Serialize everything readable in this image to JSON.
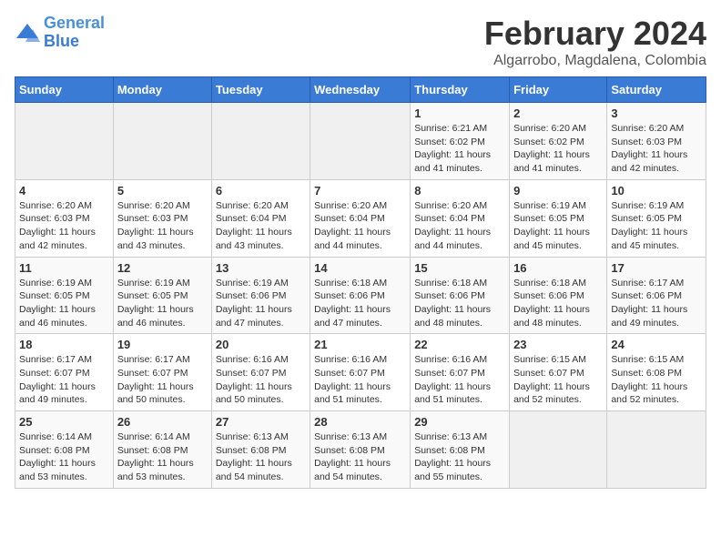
{
  "header": {
    "logo_line1": "General",
    "logo_line2": "Blue",
    "month": "February 2024",
    "location": "Algarrobo, Magdalena, Colombia"
  },
  "weekdays": [
    "Sunday",
    "Monday",
    "Tuesday",
    "Wednesday",
    "Thursday",
    "Friday",
    "Saturday"
  ],
  "weeks": [
    [
      {
        "day": "",
        "info": ""
      },
      {
        "day": "",
        "info": ""
      },
      {
        "day": "",
        "info": ""
      },
      {
        "day": "",
        "info": ""
      },
      {
        "day": "1",
        "info": "Sunrise: 6:21 AM\nSunset: 6:02 PM\nDaylight: 11 hours\nand 41 minutes."
      },
      {
        "day": "2",
        "info": "Sunrise: 6:20 AM\nSunset: 6:02 PM\nDaylight: 11 hours\nand 41 minutes."
      },
      {
        "day": "3",
        "info": "Sunrise: 6:20 AM\nSunset: 6:03 PM\nDaylight: 11 hours\nand 42 minutes."
      }
    ],
    [
      {
        "day": "4",
        "info": "Sunrise: 6:20 AM\nSunset: 6:03 PM\nDaylight: 11 hours\nand 42 minutes."
      },
      {
        "day": "5",
        "info": "Sunrise: 6:20 AM\nSunset: 6:03 PM\nDaylight: 11 hours\nand 43 minutes."
      },
      {
        "day": "6",
        "info": "Sunrise: 6:20 AM\nSunset: 6:04 PM\nDaylight: 11 hours\nand 43 minutes."
      },
      {
        "day": "7",
        "info": "Sunrise: 6:20 AM\nSunset: 6:04 PM\nDaylight: 11 hours\nand 44 minutes."
      },
      {
        "day": "8",
        "info": "Sunrise: 6:20 AM\nSunset: 6:04 PM\nDaylight: 11 hours\nand 44 minutes."
      },
      {
        "day": "9",
        "info": "Sunrise: 6:19 AM\nSunset: 6:05 PM\nDaylight: 11 hours\nand 45 minutes."
      },
      {
        "day": "10",
        "info": "Sunrise: 6:19 AM\nSunset: 6:05 PM\nDaylight: 11 hours\nand 45 minutes."
      }
    ],
    [
      {
        "day": "11",
        "info": "Sunrise: 6:19 AM\nSunset: 6:05 PM\nDaylight: 11 hours\nand 46 minutes."
      },
      {
        "day": "12",
        "info": "Sunrise: 6:19 AM\nSunset: 6:05 PM\nDaylight: 11 hours\nand 46 minutes."
      },
      {
        "day": "13",
        "info": "Sunrise: 6:19 AM\nSunset: 6:06 PM\nDaylight: 11 hours\nand 47 minutes."
      },
      {
        "day": "14",
        "info": "Sunrise: 6:18 AM\nSunset: 6:06 PM\nDaylight: 11 hours\nand 47 minutes."
      },
      {
        "day": "15",
        "info": "Sunrise: 6:18 AM\nSunset: 6:06 PM\nDaylight: 11 hours\nand 48 minutes."
      },
      {
        "day": "16",
        "info": "Sunrise: 6:18 AM\nSunset: 6:06 PM\nDaylight: 11 hours\nand 48 minutes."
      },
      {
        "day": "17",
        "info": "Sunrise: 6:17 AM\nSunset: 6:06 PM\nDaylight: 11 hours\nand 49 minutes."
      }
    ],
    [
      {
        "day": "18",
        "info": "Sunrise: 6:17 AM\nSunset: 6:07 PM\nDaylight: 11 hours\nand 49 minutes."
      },
      {
        "day": "19",
        "info": "Sunrise: 6:17 AM\nSunset: 6:07 PM\nDaylight: 11 hours\nand 50 minutes."
      },
      {
        "day": "20",
        "info": "Sunrise: 6:16 AM\nSunset: 6:07 PM\nDaylight: 11 hours\nand 50 minutes."
      },
      {
        "day": "21",
        "info": "Sunrise: 6:16 AM\nSunset: 6:07 PM\nDaylight: 11 hours\nand 51 minutes."
      },
      {
        "day": "22",
        "info": "Sunrise: 6:16 AM\nSunset: 6:07 PM\nDaylight: 11 hours\nand 51 minutes."
      },
      {
        "day": "23",
        "info": "Sunrise: 6:15 AM\nSunset: 6:07 PM\nDaylight: 11 hours\nand 52 minutes."
      },
      {
        "day": "24",
        "info": "Sunrise: 6:15 AM\nSunset: 6:08 PM\nDaylight: 11 hours\nand 52 minutes."
      }
    ],
    [
      {
        "day": "25",
        "info": "Sunrise: 6:14 AM\nSunset: 6:08 PM\nDaylight: 11 hours\nand 53 minutes."
      },
      {
        "day": "26",
        "info": "Sunrise: 6:14 AM\nSunset: 6:08 PM\nDaylight: 11 hours\nand 53 minutes."
      },
      {
        "day": "27",
        "info": "Sunrise: 6:13 AM\nSunset: 6:08 PM\nDaylight: 11 hours\nand 54 minutes."
      },
      {
        "day": "28",
        "info": "Sunrise: 6:13 AM\nSunset: 6:08 PM\nDaylight: 11 hours\nand 54 minutes."
      },
      {
        "day": "29",
        "info": "Sunrise: 6:13 AM\nSunset: 6:08 PM\nDaylight: 11 hours\nand 55 minutes."
      },
      {
        "day": "",
        "info": ""
      },
      {
        "day": "",
        "info": ""
      }
    ]
  ]
}
